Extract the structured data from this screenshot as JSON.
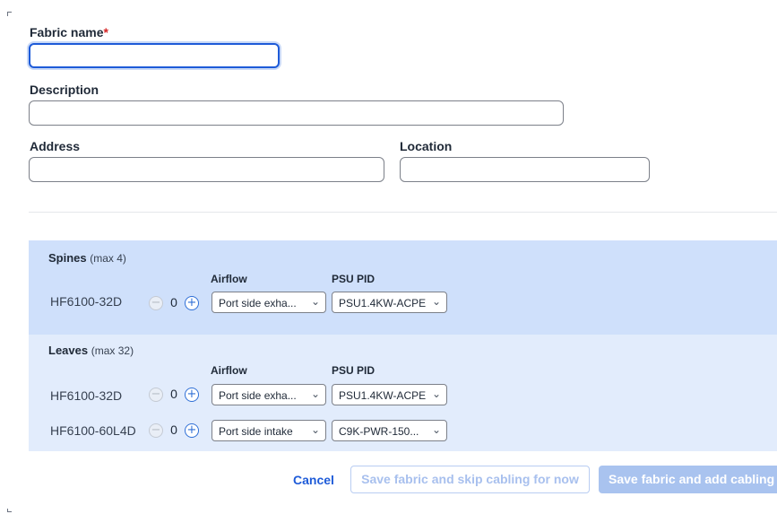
{
  "form": {
    "fabric_name_label": "Fabric name",
    "required_mark": "*",
    "fabric_name_value": "",
    "description_label": "Description",
    "description_value": "",
    "address_label": "Address",
    "address_value": "",
    "location_label": "Location",
    "location_value": ""
  },
  "spines": {
    "title": "Spines",
    "max": "(max 4)",
    "airflow_header": "Airflow",
    "psu_header": "PSU PID",
    "rows": [
      {
        "model": "HF6100-32D",
        "count": "0",
        "airflow": "Port side exha...",
        "psu": "PSU1.4KW-ACPE"
      }
    ]
  },
  "leaves": {
    "title": "Leaves",
    "max": "(max 32)",
    "airflow_header": "Airflow",
    "psu_header": "PSU PID",
    "rows": [
      {
        "model": "HF6100-32D",
        "count": "0",
        "airflow": "Port side exha...",
        "psu": "PSU1.4KW-ACPE"
      },
      {
        "model": "HF6100-60L4D",
        "count": "0",
        "airflow": "Port side intake",
        "psu": "C9K-PWR-150..."
      }
    ]
  },
  "icons": {
    "minus": "−",
    "plus": "+",
    "chevron": "⌄"
  },
  "actions": {
    "cancel": "Cancel",
    "save_skip": "Save fabric and skip cabling for now",
    "save_add": "Save fabric and add cabling"
  },
  "colors": {
    "accent": "#1e5bd8",
    "spines_bg": "#cfe0fb",
    "leaves_bg": "#e2ecfc",
    "required": "#d42424"
  }
}
